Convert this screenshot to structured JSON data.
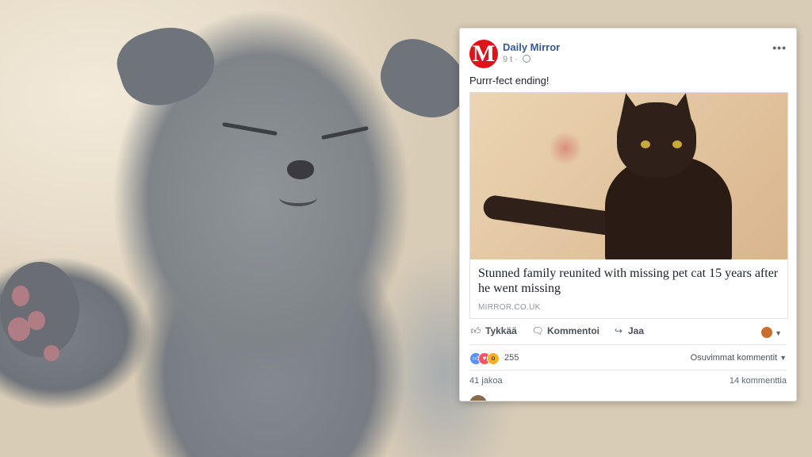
{
  "post": {
    "page_name": "Daily Mirror",
    "logo_letter": "M",
    "time": "9 t",
    "time_separator": "·",
    "more_icon": "more-dots-icon",
    "message": "Purrr-fect ending!",
    "link": {
      "title": "Stunned family reunited with missing pet cat 15 years after he went missing",
      "domain": "MIRROR.CO.UK"
    },
    "actions": {
      "like": "Tykkää",
      "comment": "Kommentoi",
      "share": "Jaa"
    },
    "reaction_count": "255",
    "sort_label": "Osuvimmat kommentit",
    "shares": "41 jakoa",
    "comments": "14 kommenttia"
  },
  "colors": {
    "brand_red": "#e11219",
    "link_blue": "#365899"
  }
}
